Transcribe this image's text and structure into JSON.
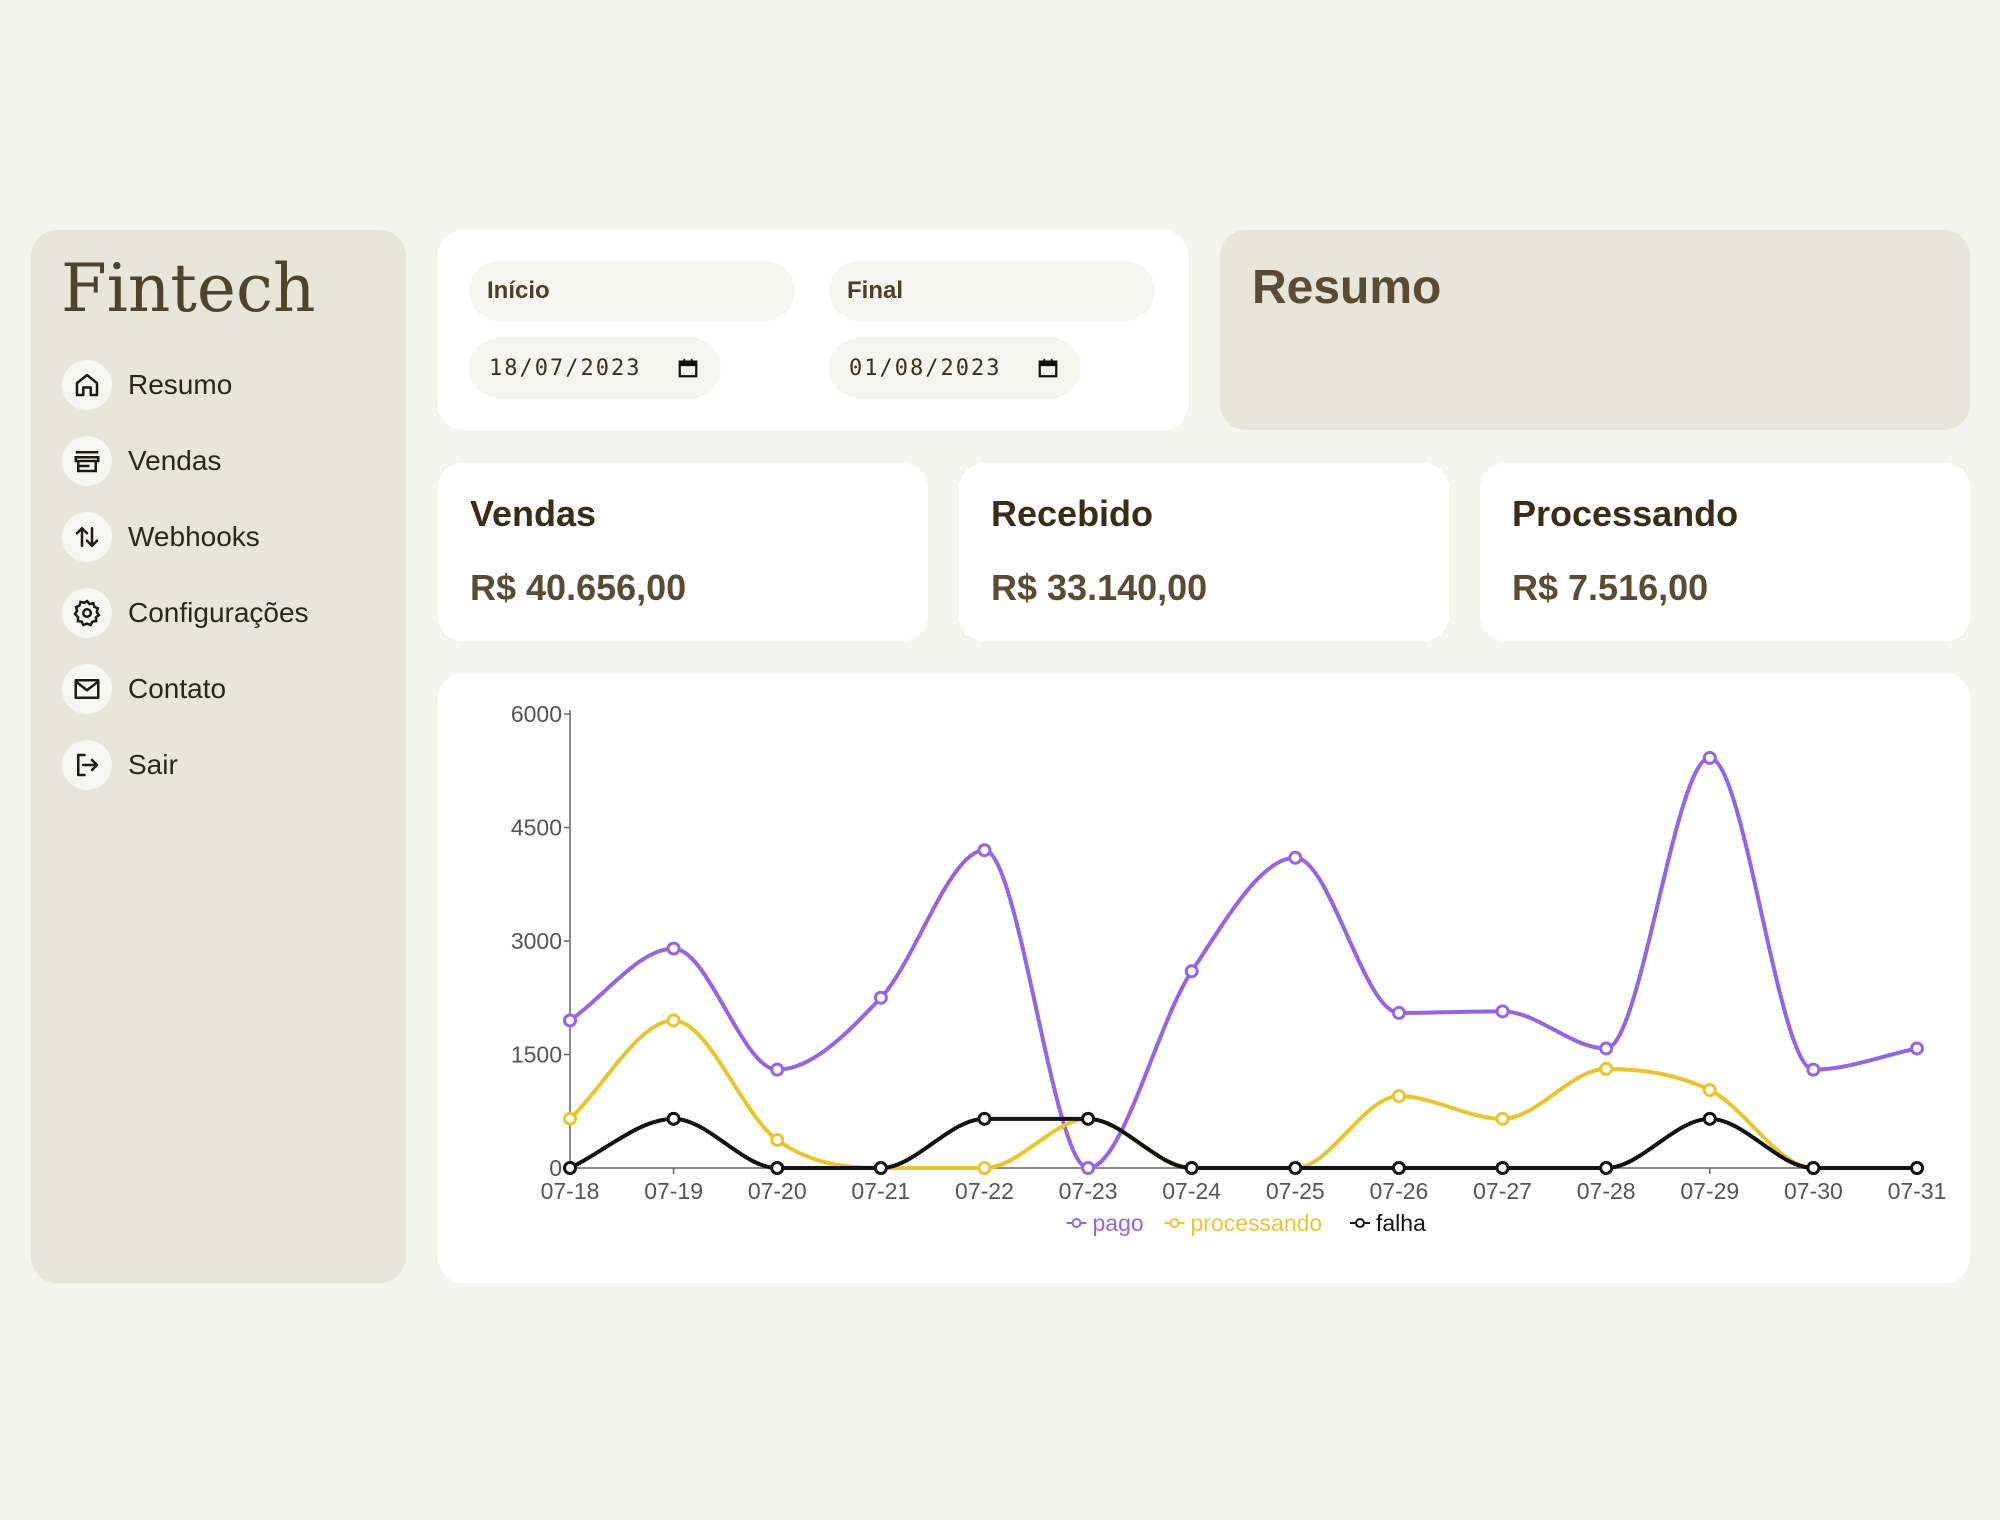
{
  "sidebar": {
    "logo": "Fintech",
    "items": [
      {
        "label": "Resumo",
        "icon": "home-icon"
      },
      {
        "label": "Vendas",
        "icon": "store-icon"
      },
      {
        "label": "Webhooks",
        "icon": "arrows-up-down-icon"
      },
      {
        "label": "Configurações",
        "icon": "gear-icon"
      },
      {
        "label": "Contato",
        "icon": "mail-icon"
      },
      {
        "label": "Sair",
        "icon": "logout-icon"
      }
    ]
  },
  "dates": {
    "start_label": "Início",
    "start_value": "18/07/2023",
    "end_label": "Final",
    "end_value": "01/08/2023"
  },
  "resumo": {
    "title": "Resumo"
  },
  "stats": [
    {
      "title": "Vendas",
      "value": "R$ 40.656,00"
    },
    {
      "title": "Recebido",
      "value": "R$ 33.140,00"
    },
    {
      "title": "Processando",
      "value": "R$ 7.516,00"
    }
  ],
  "colors": {
    "pago": "#9763ea",
    "processando": "#ecc52a",
    "falha": "#111111",
    "sidebar_bg": "#e8e6d8",
    "page_bg": "#f5f5f0"
  },
  "chart_data": {
    "type": "line",
    "categories": [
      "07-18",
      "07-19",
      "07-20",
      "07-21",
      "07-22",
      "07-23",
      "07-24",
      "07-25",
      "07-26",
      "07-27",
      "07-28",
      "07-29",
      "07-30",
      "07-31"
    ],
    "series": [
      {
        "name": "pago",
        "values": [
          1950,
          2900,
          1300,
          2250,
          4200,
          0,
          2600,
          4100,
          2050,
          2070,
          1580,
          5420,
          1300,
          1580
        ]
      },
      {
        "name": "processando",
        "values": [
          650,
          1950,
          370,
          0,
          0,
          650,
          0,
          0,
          950,
          650,
          1310,
          1030,
          0,
          0
        ]
      },
      {
        "name": "falha",
        "values": [
          0,
          650,
          0,
          0,
          650,
          650,
          0,
          0,
          0,
          0,
          0,
          650,
          0,
          0
        ]
      }
    ],
    "yticks": [
      0,
      1500,
      3000,
      4500,
      6000
    ],
    "ylim": [
      0,
      6000
    ],
    "legend": "bottom-center",
    "grid": false
  }
}
